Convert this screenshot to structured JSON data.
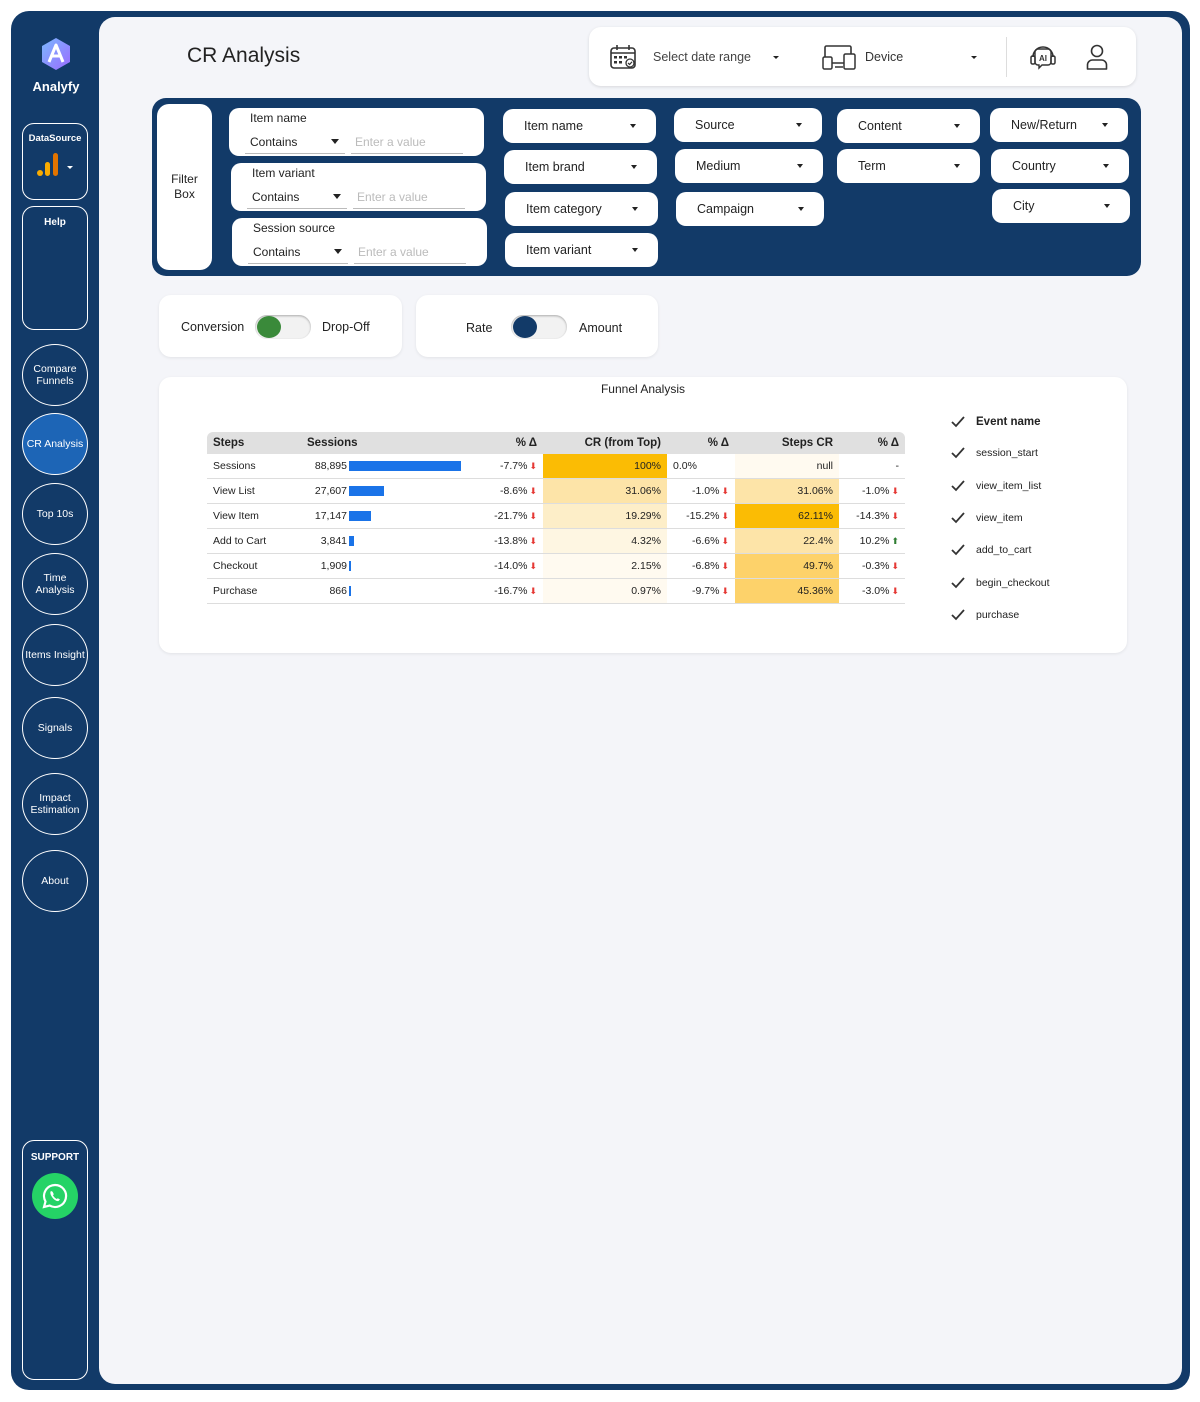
{
  "app": {
    "name": "Analyfy"
  },
  "sidebar": {
    "datasource_label": "DataSource",
    "help_label": "Help",
    "nav": [
      {
        "label": "Compare Funnels",
        "active": false
      },
      {
        "label": "CR Analysis",
        "active": true
      },
      {
        "label": "Top 10s",
        "active": false
      },
      {
        "label": "Time Analysis",
        "active": false
      },
      {
        "label": "Items Insight",
        "active": false
      },
      {
        "label": "Signals",
        "active": false
      },
      {
        "label": "Impact Estimation",
        "active": false
      },
      {
        "label": "About",
        "active": false
      }
    ],
    "support_label": "SUPPORT"
  },
  "header": {
    "title": "CR Analysis",
    "date_range": "Select date range",
    "device": "Device"
  },
  "filter_box": {
    "label": "Filter Box",
    "text_filters": [
      {
        "label": "Item name",
        "operator": "Contains",
        "placeholder": "Enter a value"
      },
      {
        "label": "Item variant",
        "operator": "Contains",
        "placeholder": "Enter a value"
      },
      {
        "label": "Session source",
        "operator": "Contains",
        "placeholder": "Enter a value"
      }
    ],
    "dropdowns": {
      "col1": [
        "Item name",
        "Item brand",
        "Item category",
        "Item variant"
      ],
      "col2": [
        "Source",
        "Medium",
        "Campaign"
      ],
      "col3": [
        "Content",
        "Term"
      ],
      "col4": [
        "New/Return",
        "Country",
        "City"
      ]
    }
  },
  "toggles": {
    "conv": {
      "left": "Conversion",
      "right": "Drop-Off",
      "color": "#3a8a3a"
    },
    "rate": {
      "left": "Rate",
      "right": "Amount",
      "color": "#123a68"
    }
  },
  "funnel": {
    "title": "Funnel Analysis",
    "columns": [
      "Steps",
      "Sessions",
      "% Δ",
      "CR (from Top)",
      "% Δ",
      "Steps CR",
      "% Δ"
    ],
    "rows": [
      {
        "step": "Sessions",
        "sessions": "88,895",
        "sessions_value": 88895,
        "d1": "-7.7%",
        "d1_dir": "down",
        "cr_top": "100%",
        "cr_top_value": 100,
        "d2": "0.0%",
        "d2_dir": "none",
        "steps_cr": "null",
        "steps_cr_value": null,
        "d3": "-",
        "d3_dir": "none"
      },
      {
        "step": "View List",
        "sessions": "27,607",
        "sessions_value": 27607,
        "d1": "-8.6%",
        "d1_dir": "down",
        "cr_top": "31.06%",
        "cr_top_value": 31.06,
        "d2": "-1.0%",
        "d2_dir": "down",
        "steps_cr": "31.06%",
        "steps_cr_value": 31.06,
        "d3": "-1.0%",
        "d3_dir": "down"
      },
      {
        "step": "View Item",
        "sessions": "17,147",
        "sessions_value": 17147,
        "d1": "-21.7%",
        "d1_dir": "down",
        "cr_top": "19.29%",
        "cr_top_value": 19.29,
        "d2": "-15.2%",
        "d2_dir": "down",
        "steps_cr": "62.11%",
        "steps_cr_value": 62.11,
        "d3": "-14.3%",
        "d3_dir": "down"
      },
      {
        "step": "Add to Cart",
        "sessions": "3,841",
        "sessions_value": 3841,
        "d1": "-13.8%",
        "d1_dir": "down",
        "cr_top": "4.32%",
        "cr_top_value": 4.32,
        "d2": "-6.6%",
        "d2_dir": "down",
        "steps_cr": "22.4%",
        "steps_cr_value": 22.4,
        "d3": "10.2%",
        "d3_dir": "up"
      },
      {
        "step": "Checkout",
        "sessions": "1,909",
        "sessions_value": 1909,
        "d1": "-14.0%",
        "d1_dir": "down",
        "cr_top": "2.15%",
        "cr_top_value": 2.15,
        "d2": "-6.8%",
        "d2_dir": "down",
        "steps_cr": "49.7%",
        "steps_cr_value": 49.7,
        "d3": "-0.3%",
        "d3_dir": "down"
      },
      {
        "step": "Purchase",
        "sessions": "866",
        "sessions_value": 866,
        "d1": "-16.7%",
        "d1_dir": "down",
        "cr_top": "0.97%",
        "cr_top_value": 0.97,
        "d2": "-9.7%",
        "d2_dir": "down",
        "steps_cr": "45.36%",
        "steps_cr_value": 45.36,
        "d3": "-3.0%",
        "d3_dir": "down"
      }
    ]
  },
  "events": {
    "header": "Event name",
    "items": [
      "session_start",
      "view_item_list",
      "view_item",
      "add_to_cart",
      "begin_checkout",
      "purchase"
    ]
  },
  "colors": {
    "navy": "#123a68",
    "accent_blue": "#1a73e8",
    "amber": "#fbbc04",
    "whatsapp": "#25d366",
    "down": "#e53935",
    "up": "#2e7d32"
  }
}
